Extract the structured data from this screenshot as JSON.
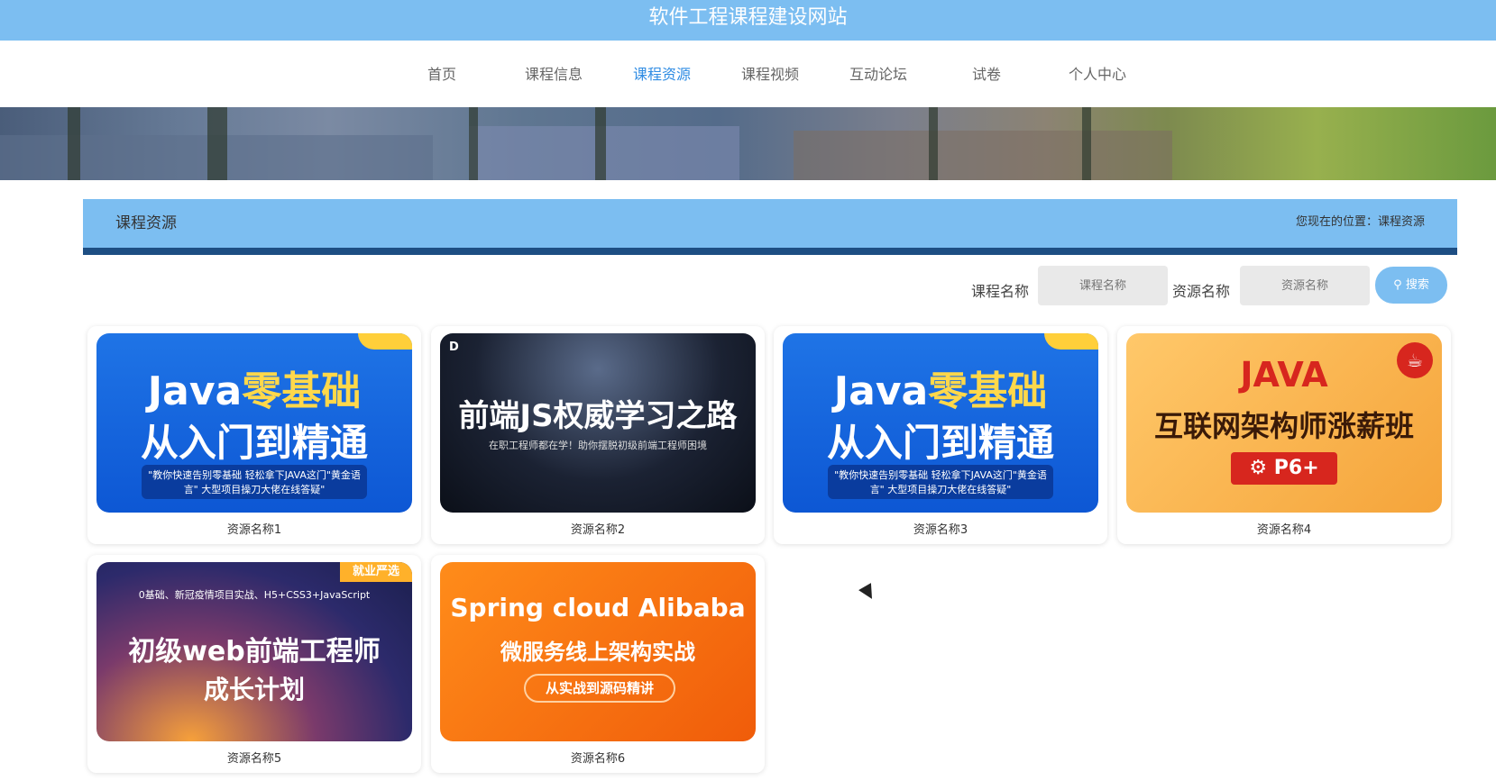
{
  "site_title": "软件工程课程建设网站",
  "nav": {
    "items": [
      {
        "label": "首页"
      },
      {
        "label": "课程信息"
      },
      {
        "label": "课程资源",
        "active": true
      },
      {
        "label": "课程视频"
      },
      {
        "label": "互动论坛"
      },
      {
        "label": "试卷"
      },
      {
        "label": "个人中心"
      }
    ]
  },
  "section": {
    "title": "课程资源",
    "location": "您现在的位置：课程资源"
  },
  "search": {
    "course_label": "课程名称",
    "course_placeholder": "课程名称",
    "resource_label": "资源名称",
    "resource_placeholder": "资源名称",
    "button_label": "搜索"
  },
  "cards": [
    {
      "name": "资源名称1",
      "thumb": {
        "l1a": "Java",
        "l1b": "零基础",
        "l2": "从入门到精通",
        "l3": "\"教你快速告别零基础  轻松拿下JAVA这门\"黄金语言\" 大型项目操刀大佬在线答疑\""
      }
    },
    {
      "name": "资源名称2",
      "thumb": {
        "l1": "前端JS权威学习之路",
        "l2": "在职工程师都在学！助你摆脱初级前端工程师困境"
      }
    },
    {
      "name": "资源名称3",
      "thumb": {
        "l1a": "Java",
        "l1b": "零基础",
        "l2": "从入门到精通",
        "l3": "\"教你快速告别零基础  轻松拿下JAVA这门\"黄金语言\" 大型项目操刀大佬在线答疑\""
      }
    },
    {
      "name": "资源名称4",
      "thumb": {
        "l1": "JAVA",
        "l2": "互联网架构师涨薪班",
        "badge": "⚙ P6+"
      }
    },
    {
      "name": "资源名称5",
      "thumb": {
        "tag": "就业严选",
        "l0": "0基础、新冠疫情项目实战、H5+CSS3+JavaScript",
        "l1": "初级web前端工程师",
        "l2": "成长计划"
      }
    },
    {
      "name": "资源名称6",
      "thumb": {
        "l1": "Spring cloud Alibaba",
        "l2": "微服务线上架构实战",
        "l3": "从实战到源码精讲"
      }
    }
  ]
}
